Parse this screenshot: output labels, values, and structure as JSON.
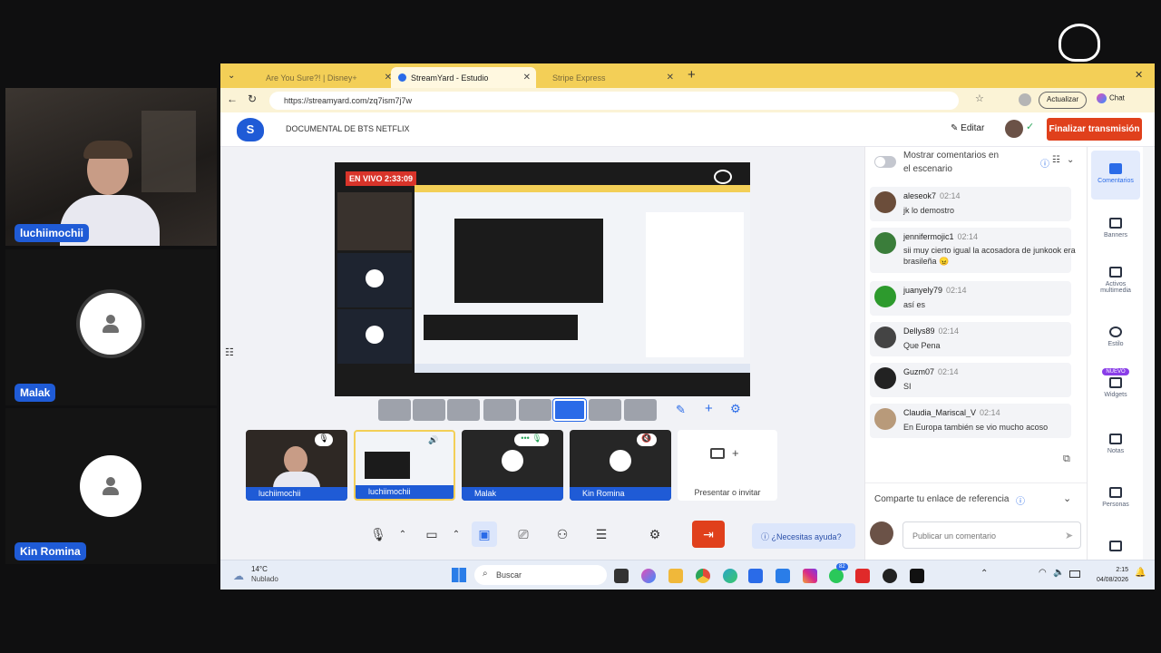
{
  "participants": [
    {
      "name": "luchiimochii"
    },
    {
      "name": "Malak"
    },
    {
      "name": "Kin Romina"
    }
  ],
  "brand": {
    "logo_text": "streamyard"
  },
  "browser": {
    "tabs": [
      {
        "label": "Are You Sure?! | Disney+"
      },
      {
        "label": "StreamYard - Estudio"
      },
      {
        "label": "Stripe Express"
      }
    ],
    "url": "https://streamyard.com/zq7ism7j7w",
    "update_label": "Actualizar",
    "chat_label": "Chat"
  },
  "studio": {
    "broadcast_title": "DOCUMENTAL DE BTS NETFLIX",
    "edit_label": "Editar",
    "end_label": "Finalizar transmisión",
    "live_badge": "EN VIVO 2:33:09",
    "present_label": "Presentar o invitar",
    "help_label": "¿Necesitas ayuda?"
  },
  "thumbs": [
    {
      "label": "luchiimochii"
    },
    {
      "label": "luchiimochii"
    },
    {
      "label": "Malak"
    },
    {
      "label": "Kin Romina"
    }
  ],
  "comments_panel": {
    "toggle_label": "Mostrar comentarios en el escenario",
    "share_label": "Comparte tu enlace de referencia",
    "input_placeholder": "Publicar un comentario",
    "comments": [
      {
        "user": "aleseok7",
        "time": "02:14",
        "text": "jk lo demostro",
        "color": "#6b4d3a"
      },
      {
        "user": "jennifermojic1",
        "time": "02:14",
        "text": "sii muy cierto igual la acosadora de junkook era brasileña 😠",
        "color": "#3a7d3a"
      },
      {
        "user": "juanyely79",
        "time": "02:14",
        "text": "así es",
        "color": "#2d9a2d"
      },
      {
        "user": "Dellys89",
        "time": "02:14",
        "text": "Que Pena",
        "color": "#444444"
      },
      {
        "user": "Guzm07",
        "time": "02:14",
        "text": "SI",
        "color": "#222222"
      },
      {
        "user": "Claudia_Mariscal_V",
        "time": "02:14",
        "text": "En Europa también se vio mucho acoso",
        "color": "#b89a7a"
      }
    ]
  },
  "rail": [
    {
      "label": "Comentarios"
    },
    {
      "label": "Banners"
    },
    {
      "label": "Activos multimedia"
    },
    {
      "label": "Estilo"
    },
    {
      "label": "Widgets",
      "badge": "NUEVO"
    },
    {
      "label": "Notas"
    },
    {
      "label": "Personas"
    }
  ],
  "taskbar": {
    "weather_temp": "14°C",
    "weather_text": "Nublado",
    "search_label": "Buscar",
    "time": "2:15",
    "date": "04/08/2026",
    "whatsapp_badge": "82"
  },
  "colors": {
    "accent": "#1f5bd6",
    "end_button": "#e0401c",
    "tabbar": "#f3cf57",
    "live": "#d8342a"
  }
}
